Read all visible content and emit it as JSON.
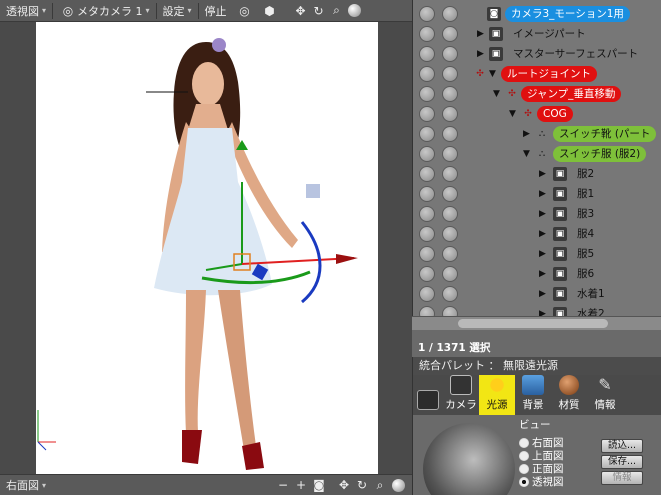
{
  "viewport": {
    "view_mode": "透視図",
    "camera": "メタカメラ 1",
    "settings": "設定",
    "stop": "停止",
    "bottom_view": "右面図"
  },
  "outliner": {
    "rows": [
      {
        "label": "カメラ3_モーション1用",
        "style": "blue"
      },
      {
        "label": "イメージパート",
        "style": "plain"
      },
      {
        "label": "マスターサーフェスパート",
        "style": "plain"
      },
      {
        "label": "ルートジョイント",
        "style": "red"
      },
      {
        "label": "ジャンプ_垂直移動",
        "style": "red"
      },
      {
        "label": "COG",
        "style": "red"
      },
      {
        "label": "スイッチ靴 (パート",
        "style": "green"
      },
      {
        "label": "スイッチ服 (服2)",
        "style": "green"
      },
      {
        "label": "服2",
        "style": "plain"
      },
      {
        "label": "服1",
        "style": "plain"
      },
      {
        "label": "服3",
        "style": "plain"
      },
      {
        "label": "服4",
        "style": "plain"
      },
      {
        "label": "服5",
        "style": "plain"
      },
      {
        "label": "服6",
        "style": "plain"
      },
      {
        "label": "水着1",
        "style": "plain"
      },
      {
        "label": "水着2",
        "style": "plain"
      }
    ]
  },
  "selection": {
    "text": "1 / 1371 選択"
  },
  "palette": {
    "title": "統合パレット ： 無限遠光源",
    "tabs": [
      {
        "label": "カメラ"
      },
      {
        "label": "光源"
      },
      {
        "label": "背景"
      },
      {
        "label": "材質"
      },
      {
        "label": "情報"
      }
    ],
    "preview_label": "ビュー",
    "views": [
      {
        "label": "右面図",
        "selected": false
      },
      {
        "label": "上面図",
        "selected": false
      },
      {
        "label": "正面図",
        "selected": false
      },
      {
        "label": "透視図",
        "selected": true
      }
    ],
    "buttons": {
      "load": "読込...",
      "save": "保存...",
      "info": "情報"
    }
  },
  "colors": {
    "accent_blue": "#1a8fe0",
    "accent_red": "#e01010",
    "accent_green": "#7ec03a",
    "active_tab": "#f2e614"
  }
}
